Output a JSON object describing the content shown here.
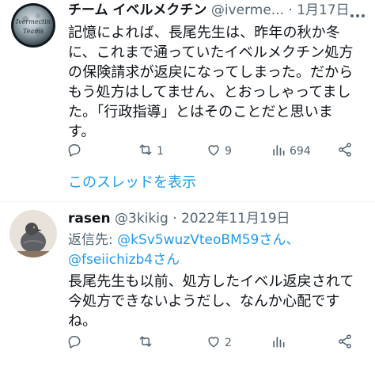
{
  "tweet1": {
    "author_name": "チーム イベルメクチン",
    "handle": "@iverme...",
    "separator": "·",
    "date": "1月17日",
    "avatar_text_line1": "Ivermectin",
    "avatar_text_line2": "Teams",
    "text_lines": [
      "記憶によれば、長尾先生は、昨年の秋か冬",
      "に、これまで通っていたイベルメクチン処方",
      "の保険請求が返戻になってしまった。だから",
      "もう処方はしてません、とおっしゃってまし",
      "た。「行政指導」とはそのことだと思いま",
      "す。"
    ],
    "actions": {
      "reply": "",
      "retweet": "1",
      "like": "9",
      "views": "694"
    },
    "thread_link": "このスレッドを表示"
  },
  "tweet2": {
    "author_name": "rasen",
    "handle": "@3kikig",
    "separator": "·",
    "date": "2022年11月19日",
    "reply_prefix": "返信先: ",
    "mention1": "@kSv5wuzVteoBM59さん、",
    "mention2": "@fseiichizb4さん",
    "text_lines": [
      "長尾先生も以前、処方したイベル返戻されて",
      "今処方できないようだし、なんか心配です",
      "ね。"
    ],
    "actions": {
      "reply": "",
      "retweet": "",
      "like": "2",
      "views": ""
    }
  },
  "colors": {
    "accent": "#1d9bf0",
    "secondary_text": "#536471",
    "primary_text": "#0f1419",
    "divider": "#eff3f4"
  },
  "icons": [
    "reply-icon",
    "retweet-icon",
    "like-icon",
    "views-icon",
    "share-icon",
    "more-icon"
  ]
}
